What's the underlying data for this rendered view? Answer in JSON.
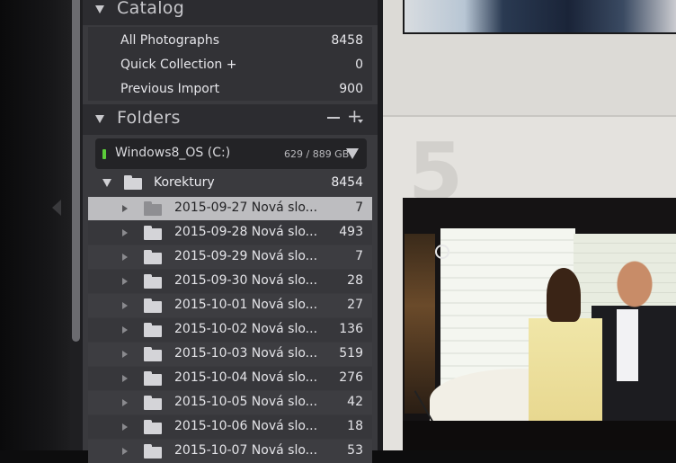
{
  "catalog": {
    "title": "Catalog",
    "items": [
      {
        "label": "All Photographs",
        "count": "8458"
      },
      {
        "label": "Quick Collection  +",
        "count": "0"
      },
      {
        "label": "Previous Import",
        "count": "900"
      }
    ]
  },
  "folders": {
    "title": "Folders",
    "minus_label": "−",
    "plus_label": "+",
    "volume": {
      "name": "Windows8_OS (C:)",
      "size": "629 / 889 GB",
      "status_color": "#5ccc3a"
    },
    "parent": {
      "label": "Korektury",
      "count": "8454"
    },
    "subfolders": [
      {
        "label": "2015-09-27 Nová slo...",
        "count": "7",
        "selected": true
      },
      {
        "label": "2015-09-28 Nová slo...",
        "count": "493"
      },
      {
        "label": "2015-09-29 Nová slo...",
        "count": "7"
      },
      {
        "label": "2015-09-30 Nová slo...",
        "count": "28"
      },
      {
        "label": "2015-10-01 Nová slo...",
        "count": "27"
      },
      {
        "label": "2015-10-02 Nová slo...",
        "count": "136"
      },
      {
        "label": "2015-10-03 Nová slo...",
        "count": "519"
      },
      {
        "label": "2015-10-04 Nová slo...",
        "count": "276"
      },
      {
        "label": "2015-10-05 Nová slo...",
        "count": "42"
      },
      {
        "label": "2015-10-06 Nová slo...",
        "count": "18"
      },
      {
        "label": "2015-10-07 Nová slo...",
        "count": "53"
      }
    ]
  },
  "grid": {
    "cell_number": "5"
  },
  "colors": {
    "panel_bg": "#3a3a3e",
    "selected_row": "#bdbdc0",
    "grid_bg": "#e8e6e2"
  }
}
